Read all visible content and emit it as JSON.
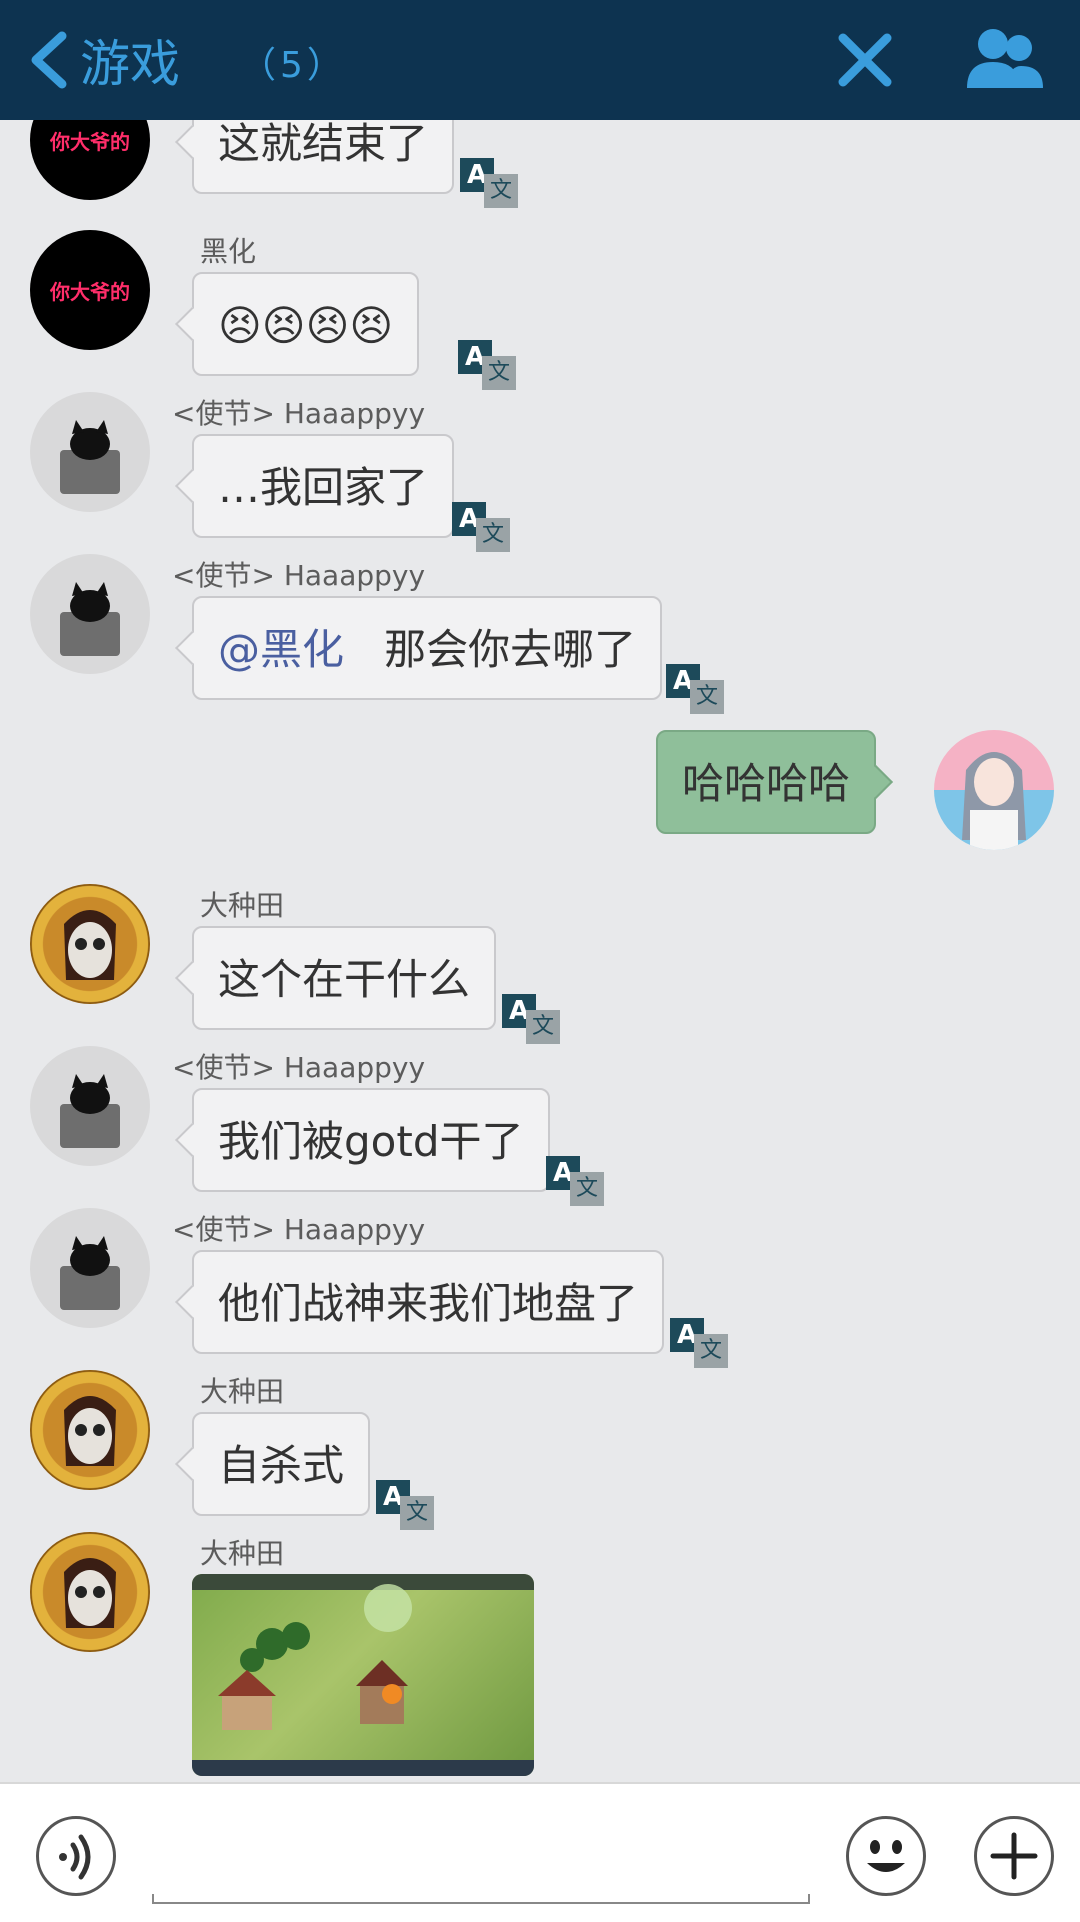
{
  "header": {
    "title": "游戏",
    "count": "（5）",
    "icons": [
      "chevron-left-icon",
      "close-icon",
      "group-members-icon"
    ],
    "accent_color": "#3a9ddc",
    "bar_color": "#0d3350"
  },
  "translate_icon": {
    "a": "A",
    "w": "文"
  },
  "messages": [
    {
      "sender": "",
      "text": "这就结束了",
      "avatar": "black-text-avatar"
    },
    {
      "sender": "黑化",
      "text": "😣😣😣😣",
      "avatar": "black-text-avatar"
    },
    {
      "sender": "<使节>   Haaappyy",
      "text": "…我回家了",
      "avatar": "cat-avatar"
    },
    {
      "sender": "<使节>   Haaappyy",
      "mention": "@黑化",
      "text": "那会你去哪了",
      "avatar": "cat-avatar"
    },
    {
      "sender": "",
      "text": "哈哈哈哈",
      "avatar": "girl-avatar",
      "mine": true
    },
    {
      "sender": "大种田",
      "text": "这个在干什么",
      "avatar": "skull-avatar"
    },
    {
      "sender": "<使节>   Haaappyy",
      "text": "我们被gotd干了",
      "avatar": "cat-avatar"
    },
    {
      "sender": "<使节>   Haaappyy",
      "text": "他们战神来我们地盘了",
      "avatar": "cat-avatar"
    },
    {
      "sender": "大种田",
      "text": "自杀式",
      "avatar": "skull-avatar"
    },
    {
      "sender": "大种田",
      "text": "",
      "avatar": "skull-avatar",
      "image": "game-screenshot"
    }
  ],
  "avatar_text": "你大爷的",
  "footer": {
    "input_value": "",
    "icons": [
      "voice-icon",
      "emoji-icon",
      "plus-icon"
    ]
  }
}
